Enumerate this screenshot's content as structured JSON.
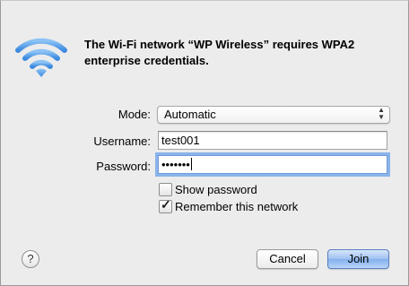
{
  "dialog": {
    "message": "The Wi-Fi network “WP Wireless” requires WPA2 enterprise credentials.",
    "icon": "wifi-icon"
  },
  "form": {
    "mode_label": "Mode:",
    "mode_value": "Automatic",
    "username_label": "Username:",
    "username_value": "test001",
    "password_label": "Password:",
    "password_value": "•••••••"
  },
  "options": {
    "show_password_label": "Show password",
    "show_password_checked": false,
    "remember_label": "Remember this network",
    "remember_checked": true
  },
  "buttons": {
    "help": "?",
    "cancel": "Cancel",
    "join": "Join"
  },
  "colors": {
    "wifi_blue": "#5aa0e8",
    "focus_ring": "#8ab4ea",
    "primary_button": "#9ec0f0"
  }
}
